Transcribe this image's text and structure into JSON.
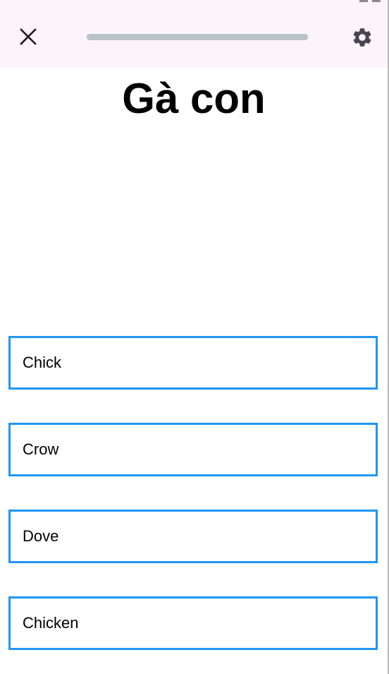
{
  "header": {
    "close_icon": "close-icon",
    "settings_icon": "gear-icon",
    "progress": 0
  },
  "question": {
    "word": "Gà con"
  },
  "options": [
    {
      "label": "Chick"
    },
    {
      "label": "Crow"
    },
    {
      "label": "Dove"
    },
    {
      "label": "Chicken"
    }
  ],
  "colors": {
    "appbar_bg": "#fdf4fb",
    "option_border": "#2196f3",
    "progress_track": "#b9c4c9"
  }
}
